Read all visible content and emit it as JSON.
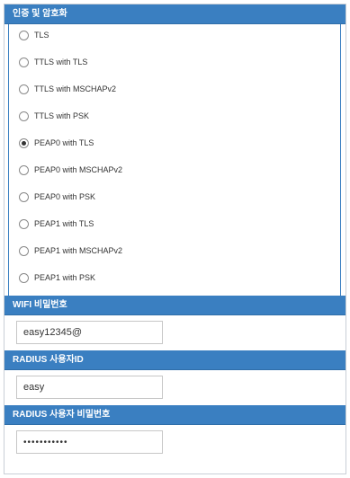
{
  "auth_section": {
    "title": "인증 및 암호화",
    "options": [
      {
        "label": "TLS",
        "checked": false
      },
      {
        "label": "TTLS with TLS",
        "checked": false
      },
      {
        "label": "TTLS with MSCHAPv2",
        "checked": false
      },
      {
        "label": "TTLS with PSK",
        "checked": false
      },
      {
        "label": "PEAP0 with TLS",
        "checked": true
      },
      {
        "label": "PEAP0 with MSCHAPv2",
        "checked": false
      },
      {
        "label": "PEAP0 with PSK",
        "checked": false
      },
      {
        "label": "PEAP1 with TLS",
        "checked": false
      },
      {
        "label": "PEAP1 with MSCHAPv2",
        "checked": false
      },
      {
        "label": "PEAP1 with PSK",
        "checked": false
      }
    ]
  },
  "wifi_password": {
    "title": "WIFI 비밀번호",
    "value": "easy12345@"
  },
  "radius_user": {
    "title": "RADIUS 사용자ID",
    "value": "easy"
  },
  "radius_password": {
    "title": "RADIUS 사용자 비밀번호",
    "value": "•••••••••••"
  },
  "colors": {
    "header_bg": "#3a7fc1",
    "header_text": "#ffffff"
  }
}
